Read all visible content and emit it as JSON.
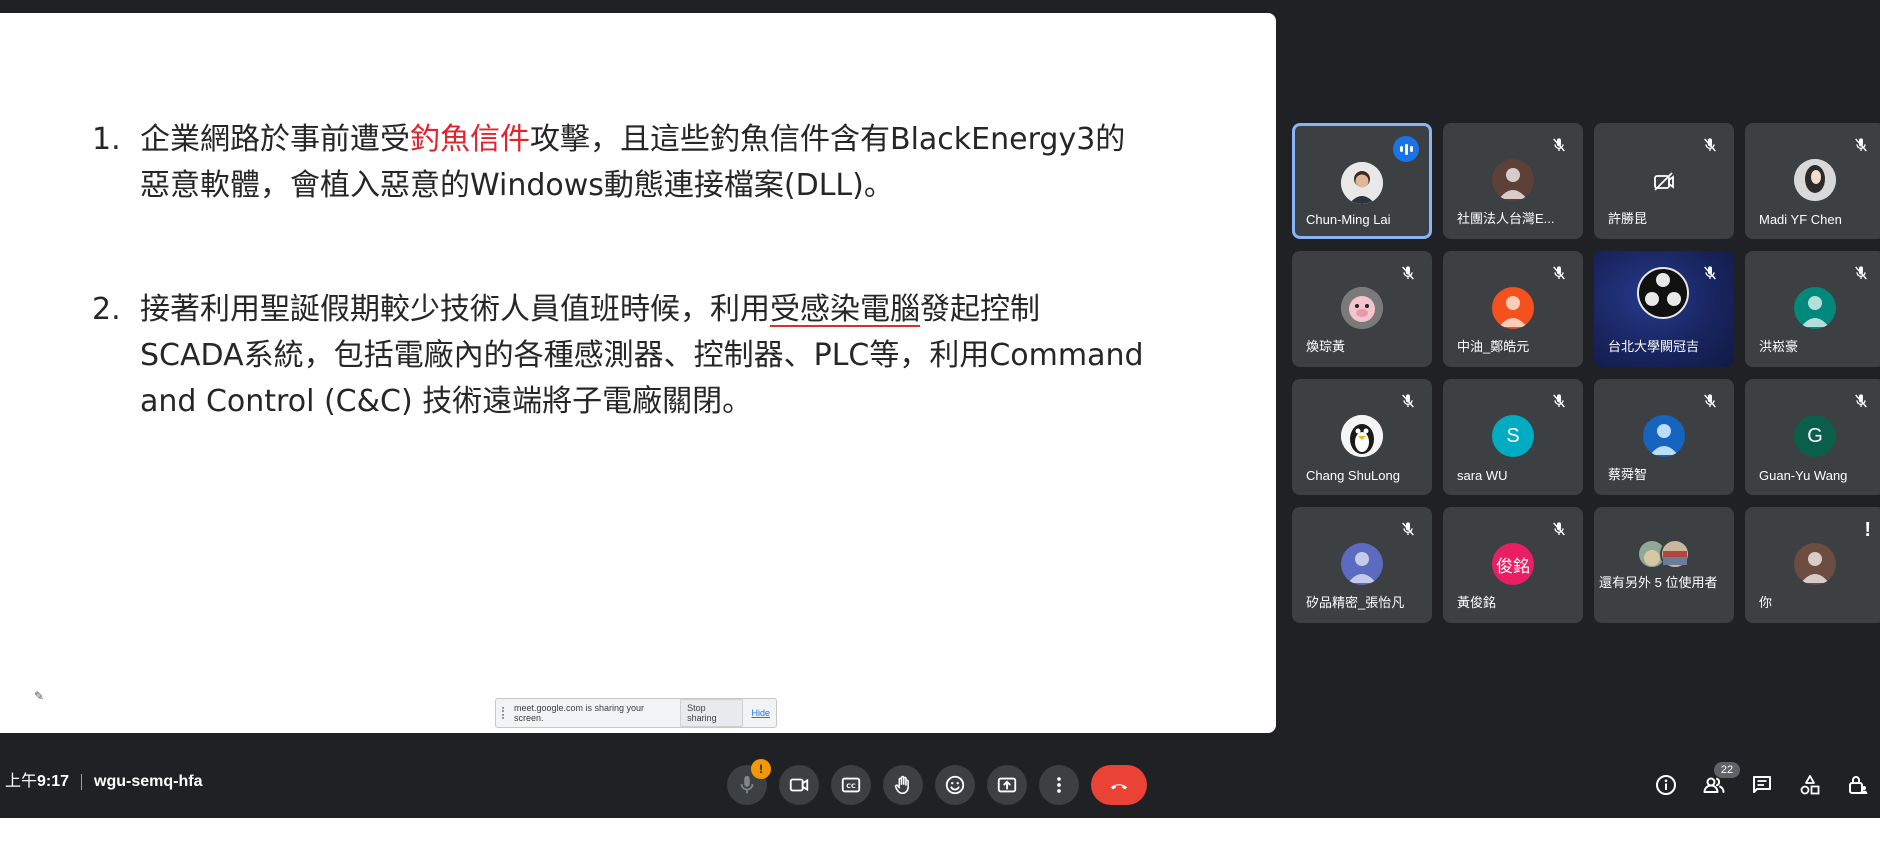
{
  "slide": {
    "item1": {
      "number": "1.",
      "pre": "企業網路於事前遭受",
      "highlight": "釣魚信件",
      "post_line1": "攻擊，且這些釣魚信件含有BlackEnergy3的",
      "line2": "惡意軟體，會植入惡意的Windows動態連接檔案(DLL)。"
    },
    "item2": {
      "number": "2.",
      "pre": "接著利用聖誕假期較少技術人員值班時候，利用",
      "underlined": "受感染電腦",
      "post_line1": "發起控制",
      "line2": "SCADA系統，包括電廠內的各種感測器、控制器、PLC等，利用Command",
      "line3": "and Control (C&C) 技術遠端將子電廠關閉。"
    }
  },
  "share_notice": {
    "message": "meet.google.com is sharing your screen.",
    "stop_label": "Stop sharing",
    "hide_label": "Hide"
  },
  "participants": [
    {
      "name": "Chun-Ming Lai"
    },
    {
      "name": "社團法人台灣E..."
    },
    {
      "name": "許勝昆"
    },
    {
      "name": "Madi YF Chen"
    },
    {
      "name": "煥琮黃"
    },
    {
      "name": "中油_鄭皓元"
    },
    {
      "name": "台北大學闕冠吉"
    },
    {
      "name": "洪崧豪"
    },
    {
      "name": "Chang ShuLong"
    },
    {
      "name": "sara WU",
      "initial": "S"
    },
    {
      "name": "蔡舜智"
    },
    {
      "name": "Guan-Yu Wang",
      "initial": "G"
    },
    {
      "name": "矽品精密_張怡凡"
    },
    {
      "name": "黃俊銘",
      "initial": "俊銘"
    },
    {
      "name": "還有另外 5 位使用者"
    },
    {
      "name": "你"
    }
  ],
  "bottom_bar": {
    "time_prefix": "上午",
    "time": "9:17",
    "meeting_code": "wgu-semq-hfa",
    "mic_alert": "!",
    "people_count": "22"
  },
  "colors": {
    "background": "#202124",
    "tile": "#3c4043",
    "speaking_border": "#8ab4f8",
    "end_call": "#ea4335",
    "highlight_red": "#e0242b"
  }
}
